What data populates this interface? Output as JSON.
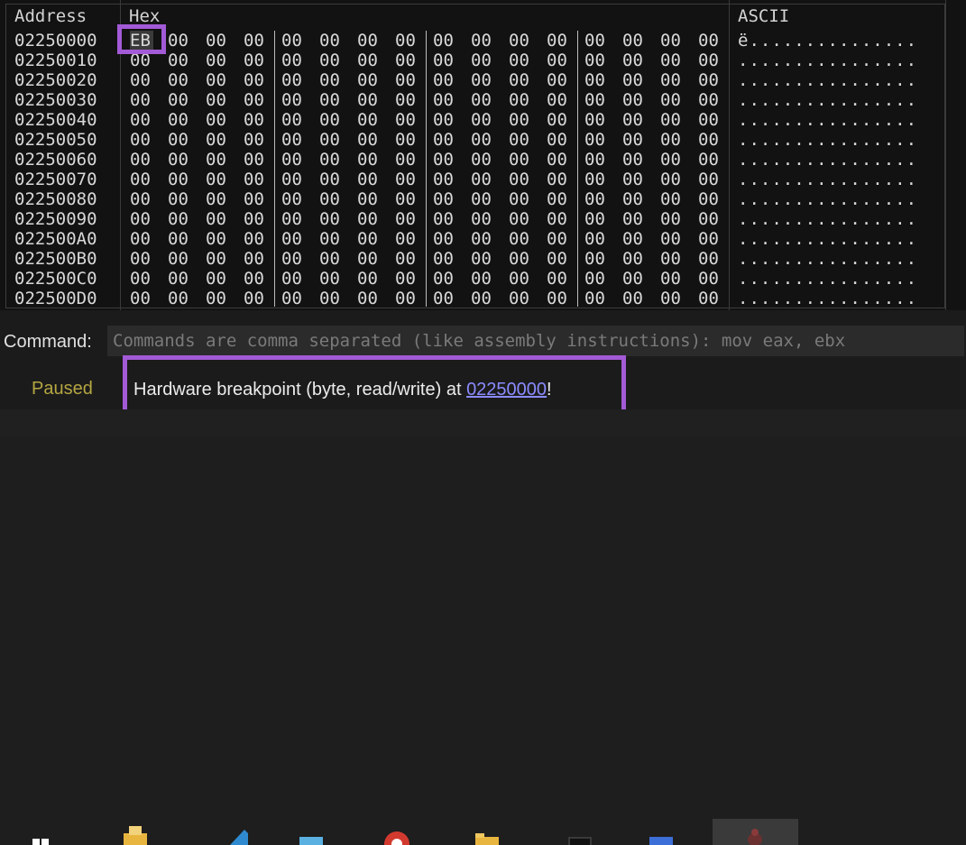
{
  "dump": {
    "headers": {
      "address": "Address",
      "hex": "Hex",
      "ascii": "ASCII"
    },
    "rows": [
      {
        "addr": "02250000",
        "bytes": [
          "EB",
          "00",
          "00",
          "00",
          "00",
          "00",
          "00",
          "00",
          "00",
          "00",
          "00",
          "00",
          "00",
          "00",
          "00",
          "00"
        ],
        "ascii": "ë..............."
      },
      {
        "addr": "02250010",
        "bytes": [
          "00",
          "00",
          "00",
          "00",
          "00",
          "00",
          "00",
          "00",
          "00",
          "00",
          "00",
          "00",
          "00",
          "00",
          "00",
          "00"
        ],
        "ascii": "................"
      },
      {
        "addr": "02250020",
        "bytes": [
          "00",
          "00",
          "00",
          "00",
          "00",
          "00",
          "00",
          "00",
          "00",
          "00",
          "00",
          "00",
          "00",
          "00",
          "00",
          "00"
        ],
        "ascii": "................"
      },
      {
        "addr": "02250030",
        "bytes": [
          "00",
          "00",
          "00",
          "00",
          "00",
          "00",
          "00",
          "00",
          "00",
          "00",
          "00",
          "00",
          "00",
          "00",
          "00",
          "00"
        ],
        "ascii": "................"
      },
      {
        "addr": "02250040",
        "bytes": [
          "00",
          "00",
          "00",
          "00",
          "00",
          "00",
          "00",
          "00",
          "00",
          "00",
          "00",
          "00",
          "00",
          "00",
          "00",
          "00"
        ],
        "ascii": "................"
      },
      {
        "addr": "02250050",
        "bytes": [
          "00",
          "00",
          "00",
          "00",
          "00",
          "00",
          "00",
          "00",
          "00",
          "00",
          "00",
          "00",
          "00",
          "00",
          "00",
          "00"
        ],
        "ascii": "................"
      },
      {
        "addr": "02250060",
        "bytes": [
          "00",
          "00",
          "00",
          "00",
          "00",
          "00",
          "00",
          "00",
          "00",
          "00",
          "00",
          "00",
          "00",
          "00",
          "00",
          "00"
        ],
        "ascii": "................"
      },
      {
        "addr": "02250070",
        "bytes": [
          "00",
          "00",
          "00",
          "00",
          "00",
          "00",
          "00",
          "00",
          "00",
          "00",
          "00",
          "00",
          "00",
          "00",
          "00",
          "00"
        ],
        "ascii": "................"
      },
      {
        "addr": "02250080",
        "bytes": [
          "00",
          "00",
          "00",
          "00",
          "00",
          "00",
          "00",
          "00",
          "00",
          "00",
          "00",
          "00",
          "00",
          "00",
          "00",
          "00"
        ],
        "ascii": "................"
      },
      {
        "addr": "02250090",
        "bytes": [
          "00",
          "00",
          "00",
          "00",
          "00",
          "00",
          "00",
          "00",
          "00",
          "00",
          "00",
          "00",
          "00",
          "00",
          "00",
          "00"
        ],
        "ascii": "................"
      },
      {
        "addr": "022500A0",
        "bytes": [
          "00",
          "00",
          "00",
          "00",
          "00",
          "00",
          "00",
          "00",
          "00",
          "00",
          "00",
          "00",
          "00",
          "00",
          "00",
          "00"
        ],
        "ascii": "................"
      },
      {
        "addr": "022500B0",
        "bytes": [
          "00",
          "00",
          "00",
          "00",
          "00",
          "00",
          "00",
          "00",
          "00",
          "00",
          "00",
          "00",
          "00",
          "00",
          "00",
          "00"
        ],
        "ascii": "................"
      },
      {
        "addr": "022500C0",
        "bytes": [
          "00",
          "00",
          "00",
          "00",
          "00",
          "00",
          "00",
          "00",
          "00",
          "00",
          "00",
          "00",
          "00",
          "00",
          "00",
          "00"
        ],
        "ascii": "................"
      },
      {
        "addr": "022500D0",
        "bytes": [
          "00",
          "00",
          "00",
          "00",
          "00",
          "00",
          "00",
          "00",
          "00",
          "00",
          "00",
          "00",
          "00",
          "00",
          "00",
          "00"
        ],
        "ascii": "................"
      }
    ]
  },
  "command": {
    "label": "Command:",
    "placeholder": "Commands are comma separated (like assembly instructions): mov eax, ebx"
  },
  "status": {
    "state": "Paused",
    "message_prefix": "Hardware breakpoint (byte, read/write) at ",
    "message_link": "02250000",
    "message_suffix": "!"
  },
  "colors": {
    "highlight": "#a25ad6",
    "paused": "#b5a642",
    "link": "#8b8bff"
  }
}
